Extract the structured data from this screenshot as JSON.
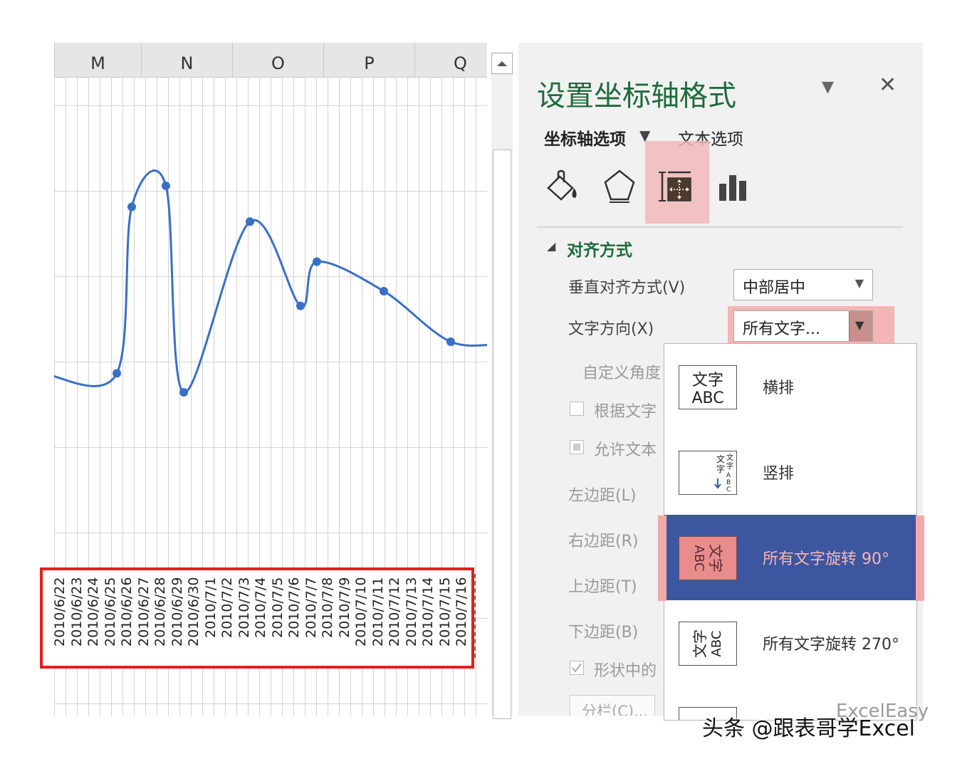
{
  "columns": [
    "M",
    "N",
    "O",
    "P",
    "Q"
  ],
  "chart_data": {
    "type": "line",
    "smooth": true,
    "markers": true,
    "line_color": "#3a6fc6",
    "x": [
      "2010/6/22",
      "2010/6/23",
      "2010/6/24",
      "2010/6/25",
      "2010/6/26",
      "2010/6/27",
      "2010/6/28",
      "2010/6/29",
      "2010/6/30",
      "2010/7/1",
      "2010/7/2",
      "2010/7/3",
      "2010/7/4",
      "2010/7/5",
      "2010/7/6",
      "2010/7/7",
      "2010/7/8",
      "2010/7/9",
      "2010/7/10",
      "2010/7/11",
      "2010/7/12",
      "2010/7/13",
      "2010/7/14",
      "2010/7/15",
      "2010/7/16"
    ],
    "point_values": [
      10,
      89,
      99,
      1,
      82,
      42,
      63,
      49,
      25,
      23
    ],
    "axis_labels_shown": [
      "2010/6/22",
      "2010/6/23",
      "2010/6/24",
      "2010/6/25",
      "2010/6/26",
      "2010/6/27",
      "2010/6/28",
      "2010/6/29",
      "2010/6/30",
      "2010/7/1",
      "2010/7/2",
      "2010/7/3",
      "2010/7/4",
      "2010/7/5",
      "2010/7/6",
      "2010/7/7",
      "2010/7/8",
      "2010/7/9",
      "2010/7/10",
      "2010/7/11",
      "2010/7/12",
      "2010/7/13",
      "2010/7/14",
      "2010/7/15",
      "2010/7/16"
    ]
  },
  "pane": {
    "title": "设置坐标轴格式",
    "tabs": {
      "axis_options": "坐标轴选项",
      "text_options": "文本选项"
    },
    "section_title": "对齐方式",
    "vertical_align_label": "垂直对齐方式(V)",
    "vertical_align_value": "中部居中",
    "text_direction_label": "文字方向(X)",
    "text_direction_value": "所有文字...",
    "custom_angle_label": "自定义角度",
    "resize_label": "根据文字",
    "overflow_label": "允许文本",
    "left_margin_label": "左边距(L)",
    "right_margin_label": "右边距(R)",
    "top_margin_label": "上边距(T)",
    "bottom_margin_label": "下边距(B)",
    "wrap_label": "形状中的",
    "columns_button": "分栏(C)..."
  },
  "menu": {
    "items": [
      {
        "icon_text": "文字\nABC",
        "label": "横排"
      },
      {
        "icon_text": "文字",
        "label": "竖排"
      },
      {
        "icon_text": "文字ABC",
        "label": "所有文字旋转 90°"
      },
      {
        "icon_text": "文字ABC",
        "label": "所有文字旋转 270°"
      }
    ],
    "selected_index": 2,
    "selected_bg": "#3d56a0"
  },
  "watermark": "头条 @跟表哥学Excel",
  "watermark_faint": "ExcelEasy"
}
